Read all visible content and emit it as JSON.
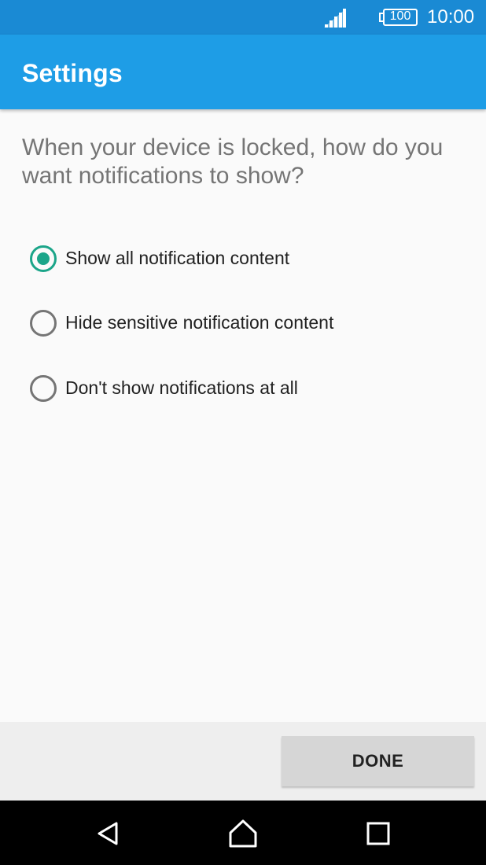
{
  "status_bar": {
    "battery": "100",
    "time": "10:00",
    "icons": [
      "signal-icon",
      "battery-icon"
    ]
  },
  "app_bar": {
    "title": "Settings"
  },
  "question": "When your device is locked, how do you want notifications to show?",
  "options": [
    {
      "label": "Show all notification content",
      "selected": true
    },
    {
      "label": "Hide sensitive notification content",
      "selected": false
    },
    {
      "label": "Don't show notifications at all",
      "selected": false
    }
  ],
  "footer": {
    "done_label": "DONE"
  },
  "nav_bar": {
    "icons": [
      "back-icon",
      "home-icon",
      "recents-icon"
    ]
  },
  "colors": {
    "status_bar": "#1a8ad4",
    "app_bar": "#1e9de6",
    "accent": "#1ba589",
    "background": "#fafafa"
  }
}
